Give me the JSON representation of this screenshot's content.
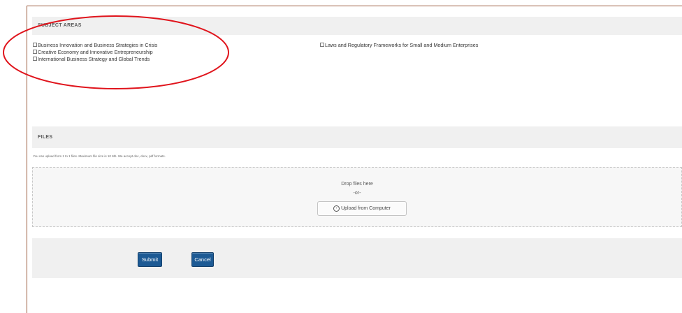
{
  "subject_areas": {
    "header": "SUBJECT AREAS",
    "left": [
      "Business Innovation and Business Strategies in Crisis",
      "Creative Economy and Innovative Entrepreneurship",
      "International Business Strategy and Global Trends"
    ],
    "right": [
      "Laws and Regulatory Frameworks for Small and Medium Enterprises"
    ]
  },
  "files": {
    "header": "FILES",
    "note": "You can upload from 1 to 1 files. Maximum file size is 10 Mb. We accept doc, docx, pdf formats.",
    "drop_text": "Drop files here",
    "or_text": "-or-",
    "upload_label": "Upload from Computer",
    "upload_icon_glyph": "↑"
  },
  "actions": {
    "submit": "Submit",
    "cancel": "Cancel"
  },
  "colors": {
    "annotation": "#e0141c",
    "frame": "#9b5a3c",
    "button": "#1d5a94"
  },
  "icons": [
    "upload-icon",
    "checkbox-icon"
  ]
}
